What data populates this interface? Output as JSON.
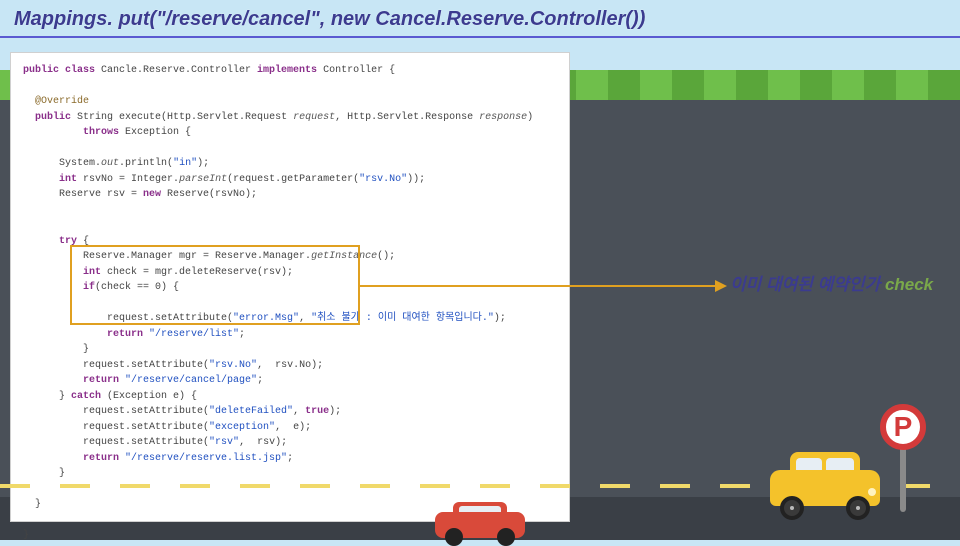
{
  "header": {
    "title": "Mappings. put(\"/reserve/cancel\", new Cancel.Reserve.Controller())"
  },
  "code": {
    "line01a": "public class",
    "line01b": " Cancle.Reserve.Controller ",
    "line01c": "implements",
    "line01d": " Controller {",
    "line03": "@Override",
    "line04a": "public",
    "line04b": " String execute(Http.Servlet.Request ",
    "line04c": "request",
    "line04d": ", Http.Servlet.Response ",
    "line04e": "response",
    "line04f": ")",
    "line05a": "throws",
    "line05b": " Exception {",
    "line07a": "System.",
    "line07b": "out",
    "line07c": ".println(",
    "line07d": "\"in\"",
    "line07e": ");",
    "line08a": "int",
    "line08b": " rsvNo = Integer.",
    "line08c": "parseInt",
    "line08d": "(request.getParameter(",
    "line08e": "\"rsv.No\"",
    "line08f": "));",
    "line09": "Reserve rsv = ",
    "line09a": "new",
    "line09b": " Reserve(rsvNo);",
    "line12a": "try",
    "line12b": " {",
    "line13": "Reserve.Manager mgr = Reserve.Manager.",
    "line13a": "getInstance",
    "line13b": "();",
    "line14a": "int",
    "line14b": " check = mgr.deleteReserve(rsv);",
    "line15a": "if",
    "line15b": "(check == 0) {",
    "line17a": "request.setAttribute(",
    "line17b": "\"error.Msg\"",
    "line17c": ", ",
    "line17d": "\"취소 불가 : 이미 대여한 항목입니다.\"",
    "line17e": ");",
    "line18a": "return ",
    "line18b": "\"/reserve/list\"",
    "line18c": ";",
    "line19": "}",
    "line20a": "request.setAttribute(",
    "line20b": "\"rsv.No\"",
    "line20c": ",  rsv.No);",
    "line21a": "return ",
    "line21b": "\"/reserve/cancel/page\"",
    "line21c": ";",
    "line22a": "} ",
    "line22b": "catch",
    "line22c": " (Exception e) {",
    "line23a": "request.setAttribute(",
    "line23b": "\"deleteFailed\"",
    "line23c": ", ",
    "line23d": "true",
    "line23e": ");",
    "line24a": "request.setAttribute(",
    "line24b": "\"exception\"",
    "line24c": ",  e);",
    "line25a": "request.setAttribute(",
    "line25b": "\"rsv\"",
    "line25c": ",  rsv);",
    "line26a": "return ",
    "line26b": "\"/reserve/reserve.list.jsp\"",
    "line26c": ";",
    "line27": "}",
    "line29": "}",
    "line31": "}"
  },
  "annotation": {
    "text_ko": "이미 대여된 예약인가 ",
    "text_en": "check"
  },
  "parking": {
    "letter": "P"
  }
}
